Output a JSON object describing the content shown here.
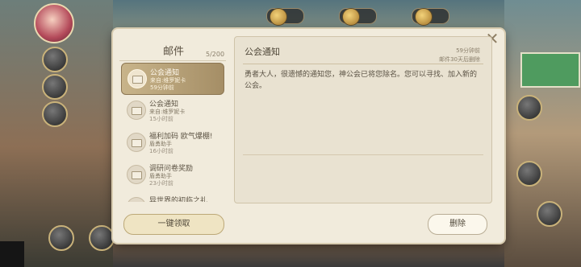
{
  "mailbox": {
    "title": "邮件",
    "count": "5/200",
    "items": [
      {
        "title": "公会通知",
        "sender": "来自:维罗妮卡",
        "time": "59分钟前",
        "active": true
      },
      {
        "title": "公会通知",
        "sender": "来自:维罗妮卡",
        "time": "15小时前",
        "active": false
      },
      {
        "title": "福利加码 欧气爆棚!",
        "sender": "盾勇助手",
        "time": "16小时前",
        "active": false
      },
      {
        "title": "调研问卷奖励",
        "sender": "盾勇助手",
        "time": "23小时前",
        "active": false
      },
      {
        "title": "异世界的初临之礼",
        "sender": "",
        "time": "",
        "active": false
      }
    ],
    "claim_all_label": "一键领取"
  },
  "detail": {
    "title": "公会通知",
    "time": "59分钟前",
    "expire": "邮件30天后删除",
    "body": "勇者大人，很遗憾的通知您，神公会已将您除名。您可以寻找、加入新的公会。",
    "delete_label": "删除"
  },
  "close_symbol": "✕",
  "icons": [
    "close-icon",
    "mail-envelope-icon",
    "avatar-portrait",
    "coin-icon"
  ]
}
